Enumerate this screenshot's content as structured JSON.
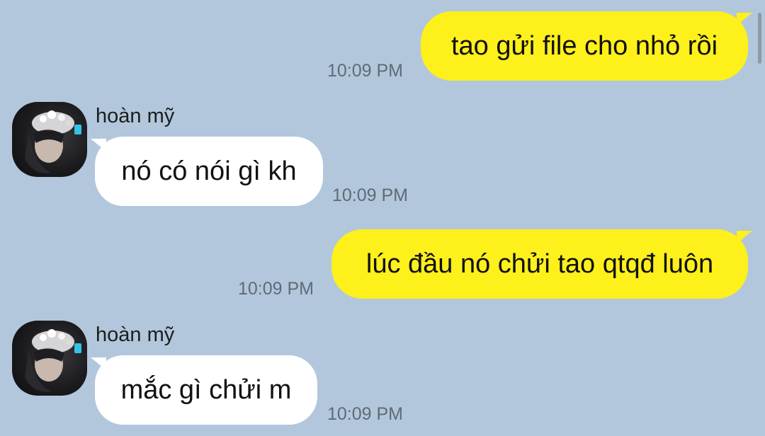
{
  "colors": {
    "background": "#b2c7dc",
    "outgoing_bubble": "#fef01b",
    "incoming_bubble": "#ffffff",
    "timestamp": "#5f6b76"
  },
  "messages": [
    {
      "direction": "outgoing",
      "text": "tao gửi file cho nhỏ rồi",
      "time": "10:09 PM"
    },
    {
      "direction": "incoming",
      "sender": "hoàn mỹ",
      "avatar_icon": "profile-photo-avatar",
      "text": "nó có nói gì kh",
      "time": "10:09 PM"
    },
    {
      "direction": "outgoing",
      "text": "lúc đầu nó chửi tao qtqđ luôn",
      "time": "10:09 PM"
    },
    {
      "direction": "incoming",
      "sender": "hoàn mỹ",
      "avatar_icon": "profile-photo-avatar",
      "text": "mắc gì chửi m",
      "time": "10:09 PM"
    }
  ]
}
